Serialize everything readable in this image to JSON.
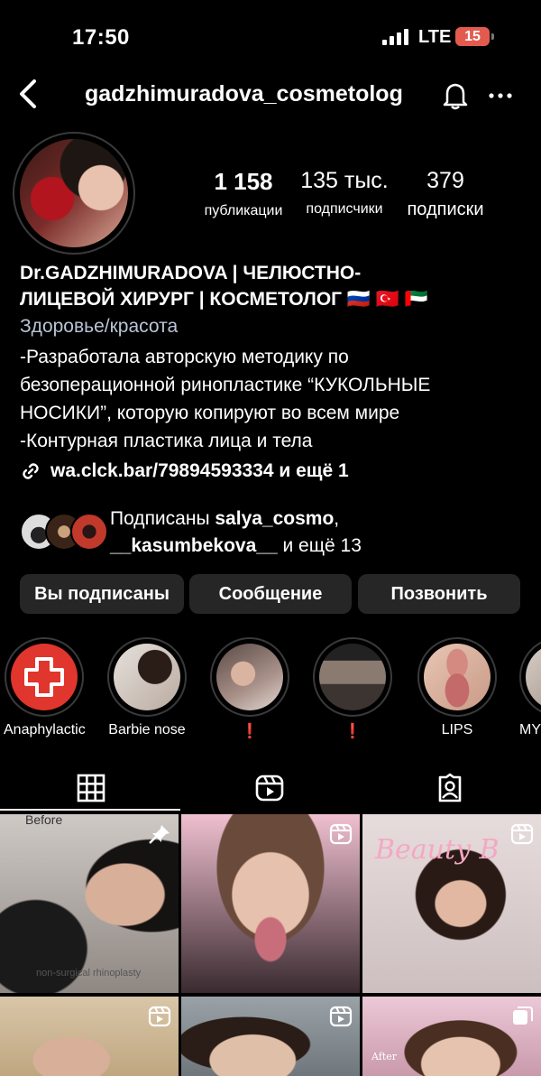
{
  "status_bar": {
    "time": "17:50",
    "network": "LTE",
    "battery": "15"
  },
  "header": {
    "username": "gadzhimuradova_cosmetolog"
  },
  "stats": [
    {
      "value": "1 158",
      "label": "публикации"
    },
    {
      "value": "135 тыс.",
      "label": "подписчики"
    },
    {
      "value": "379",
      "label": "подписки"
    }
  ],
  "bio": {
    "name_line1": "Dr.GADZHIMURADOVA |  ЧЕЛЮСТНО-",
    "name_line2": "ЛИЦЕВОЙ ХИРУРГ | КОСМЕТОЛОГ 🇷🇺 🇹🇷 🇦🇪",
    "category": "Здоровье/красота",
    "lines": [
      "-Разработала авторскую методику по",
      "безоперационной ринопластике “КУКОЛЬНЫЕ",
      "НОСИКИ”, которую копируют во всем мире",
      "-Контурная пластика лица и тела"
    ],
    "link": "wa.clck.bar/79894593334 и ещё 1"
  },
  "followed_by": {
    "prefix": "Подписаны ",
    "user1": "salya_cosmo",
    "sep": ",",
    "user2": "__kasumbekova__",
    "suffix": " и ещё 13"
  },
  "buttons": {
    "following": "Вы подписаны",
    "message": "Сообщение",
    "call": "Позвонить"
  },
  "highlights": [
    {
      "label": "Anaphylactic"
    },
    {
      "label": "Barbie nose"
    },
    {
      "label": "❗"
    },
    {
      "label": "❗"
    },
    {
      "label": "LIPS"
    },
    {
      "label": "MY"
    }
  ],
  "tabs": {
    "active": "grid"
  },
  "grid": {
    "tile1_caption": "Before",
    "tile1_footer": "non-surgical rhinoplasty",
    "tile3_sign": "Beauty B",
    "tile6_caption": "After"
  },
  "colors": {
    "background": "#000000",
    "button_bg": "#262626",
    "category_text": "#b9c4d6",
    "battery": "#e35b4f",
    "highlight_red": "#e0362d"
  }
}
